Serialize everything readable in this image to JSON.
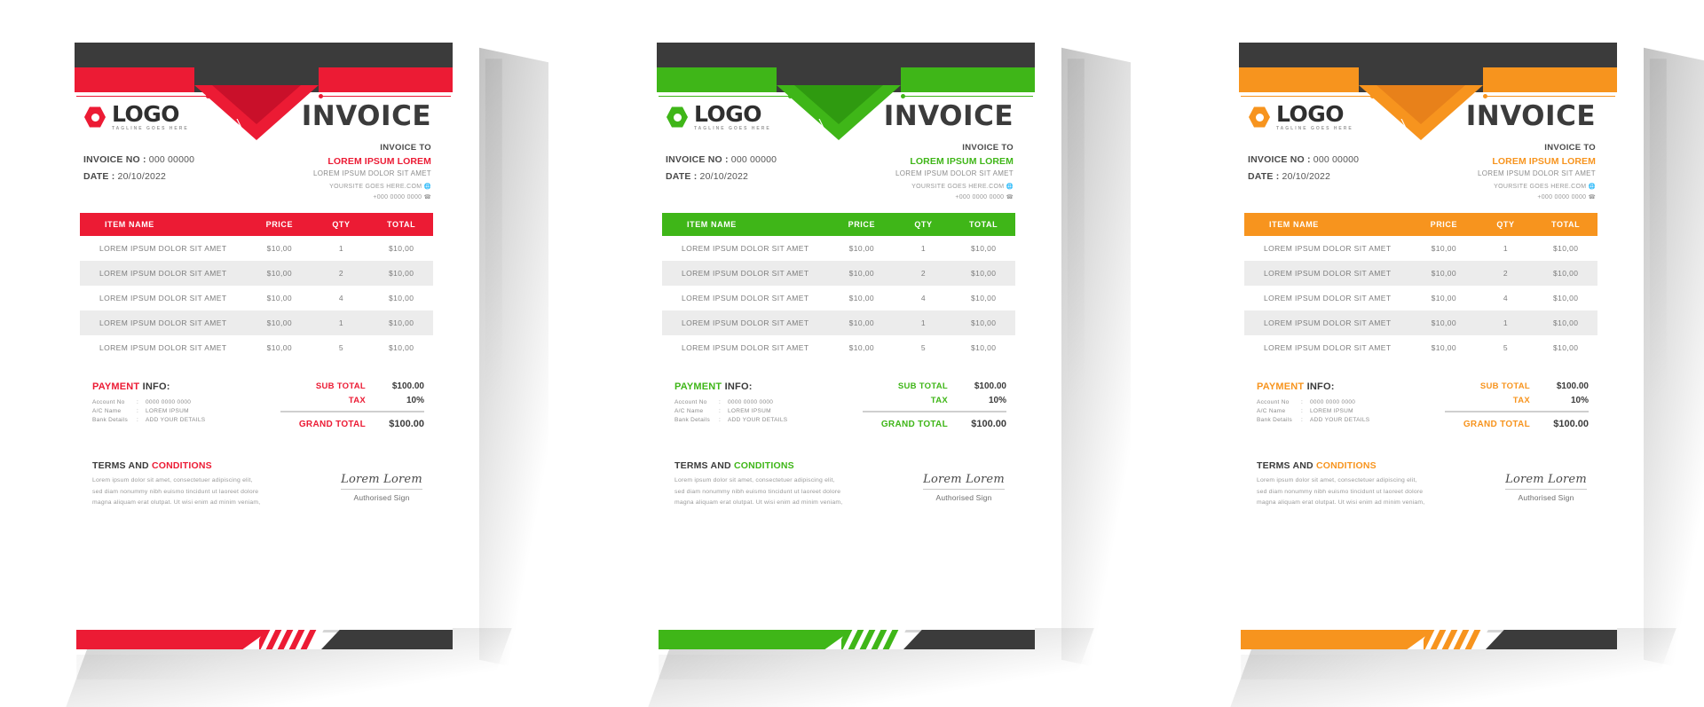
{
  "page": {
    "background": "#ffffff"
  },
  "common": {
    "logo": {
      "word": "LOGO",
      "tagline": "TAGLINE GOES HERE",
      "mark": "hexagon-logo-icon"
    },
    "invoice_title": "INVOICE",
    "meta": {
      "invoice_no_label": "INVOICE NO :",
      "invoice_no_value": "000 00000",
      "date_label": "DATE :",
      "date_value": "20/10/2022"
    },
    "invoice_to": {
      "heading": "INVOICE TO",
      "name": "LOREM IPSUM LOREM",
      "address": "LOREM IPSUM DOLOR SIT AMET",
      "website": "YOURSITE GOES HERE.COM",
      "website_icon": "globe-icon",
      "phone": "+000 0000 0000",
      "phone_icon": "phone-icon"
    },
    "table": {
      "columns": [
        "ITEM NAME",
        "PRICE",
        "QTY",
        "TOTAL"
      ],
      "rows": [
        {
          "item": "LOREM IPSUM DOLOR SIT AMET",
          "price": "$10,00",
          "qty": "1",
          "total": "$10,00"
        },
        {
          "item": "LOREM IPSUM DOLOR SIT AMET",
          "price": "$10,00",
          "qty": "2",
          "total": "$10,00"
        },
        {
          "item": "LOREM IPSUM DOLOR SIT AMET",
          "price": "$10,00",
          "qty": "4",
          "total": "$10,00"
        },
        {
          "item": "LOREM IPSUM DOLOR SIT AMET",
          "price": "$10,00",
          "qty": "1",
          "total": "$10,00"
        },
        {
          "item": "LOREM IPSUM DOLOR SIT AMET",
          "price": "$10,00",
          "qty": "5",
          "total": "$10,00"
        }
      ]
    },
    "payment": {
      "title_accent": "PAYMENT",
      "title_rest": "INFO:",
      "lines": [
        {
          "key": "Account No",
          "sep": ":",
          "value": "0000 0000 0000"
        },
        {
          "key": "A/C Name",
          "sep": ":",
          "value": "LOREM IPSUM"
        },
        {
          "key": "Bank Details",
          "sep": ":",
          "value": "ADD YOUR DETAILS"
        }
      ]
    },
    "totals": {
      "sub_total_label": "SUB TOTAL",
      "sub_total_value": "$100.00",
      "tax_label": "TAX",
      "tax_value": "10%",
      "grand_total_label": "GRAND TOTAL",
      "grand_total_value": "$100.00"
    },
    "terms": {
      "title_dark": "TERMS AND",
      "title_accent": "CONDITIONS",
      "body": "Lorem ipsum dolor sit amet, consectetuer adipiscing elit, sed diam nonummy nibh euismo tincidunt ut laoreet dolore magna aliquam erat olutpat. Ut wisi enim ad minim veniam,"
    },
    "signature": {
      "name": "Lorem Lorem",
      "label": "Authorised Sign"
    }
  },
  "variants": [
    {
      "id": "red",
      "accent": "#ec1b34",
      "accent_dark": "#c9102a",
      "dark": "#3b3b3b",
      "name": "invoice-card-red"
    },
    {
      "id": "green",
      "accent": "#3fb618",
      "accent_dark": "#2f9a10",
      "dark": "#3b3b3b",
      "name": "invoice-card-green"
    },
    {
      "id": "orange",
      "accent": "#f7941e",
      "accent_dark": "#e8811a",
      "dark": "#3b3b3b",
      "name": "invoice-card-orange"
    }
  ]
}
